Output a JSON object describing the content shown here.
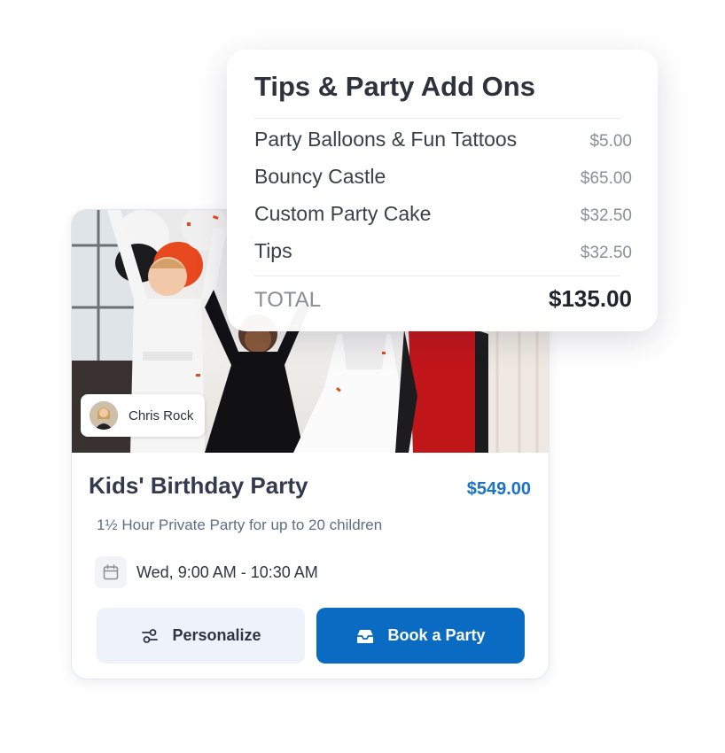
{
  "addons": {
    "title": "Tips & Party Add Ons",
    "items": [
      {
        "name": "Party Balloons & Fun Tattoos",
        "price": "$5.00"
      },
      {
        "name": "Bouncy Castle",
        "price": "$65.00"
      },
      {
        "name": "Custom Party Cake",
        "price": "$32.50"
      },
      {
        "name": "Tips",
        "price": "$32.50"
      }
    ],
    "total_label": "TOTAL",
    "total_value": "$135.00"
  },
  "event": {
    "host_name": "Chris Rock",
    "title": "Kids' Birthday Party",
    "price": "$549.00",
    "subtitle": "1½ Hour Private Party for up to 20 children",
    "schedule": "Wed, 9:00 AM - 10:30 AM",
    "personalize_label": "Personalize",
    "book_label": "Book a Party"
  },
  "colors": {
    "accent": "#0a6bc2",
    "price": "#1a73c8"
  },
  "icons": [
    "calendar-icon",
    "sliders-icon",
    "inbox-icon"
  ]
}
